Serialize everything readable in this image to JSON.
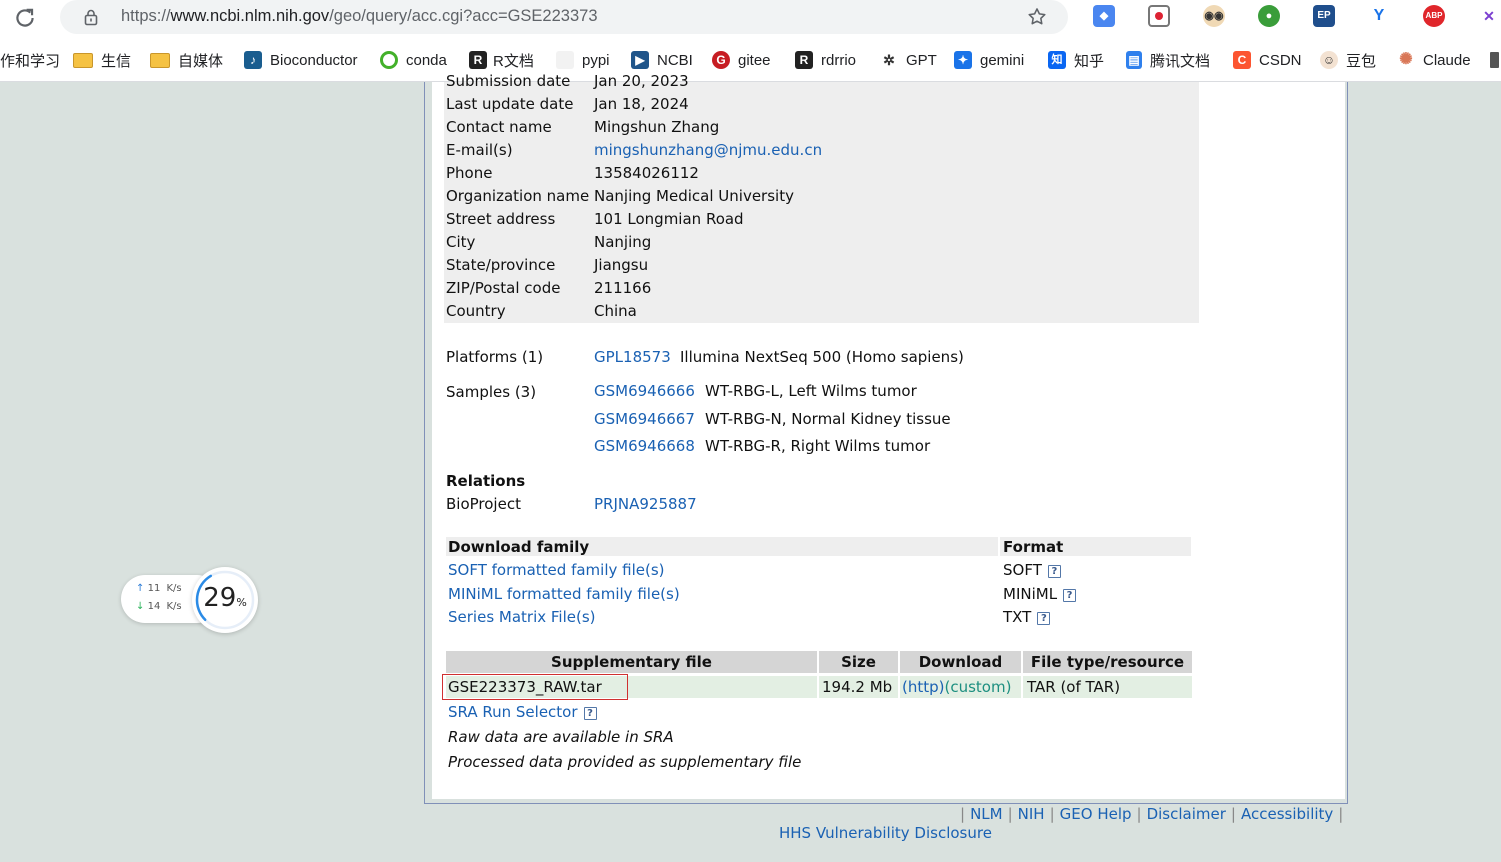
{
  "browser": {
    "url_scheme": "https://",
    "url_host": "www.ncbi.nlm.nih.gov",
    "url_path": "/geo/query/acc.cgi?acc=GSE223373"
  },
  "bookmarks": [
    {
      "label": "作和学习",
      "icon": "none"
    },
    {
      "label": "生信",
      "icon": "folder-icon"
    },
    {
      "label": "自媒体",
      "icon": "folder-icon"
    },
    {
      "label": "Bioconductor",
      "icon": "bioconductor-icon"
    },
    {
      "label": "conda",
      "icon": "conda-icon"
    },
    {
      "label": "R文档",
      "icon": "r-icon"
    },
    {
      "label": "pypi",
      "icon": "pypi-icon"
    },
    {
      "label": "NCBI",
      "icon": "ncbi-icon"
    },
    {
      "label": "gitee",
      "icon": "gitee-icon"
    },
    {
      "label": "rdrrio",
      "icon": "r-icon"
    },
    {
      "label": "GPT",
      "icon": "openai-icon"
    },
    {
      "label": "gemini",
      "icon": "gemini-icon"
    },
    {
      "label": "知乎",
      "icon": "zhihu-icon"
    },
    {
      "label": "腾讯文档",
      "icon": "doc-icon"
    },
    {
      "label": "CSDN",
      "icon": "csdn-icon"
    },
    {
      "label": "豆包",
      "icon": "doubao-icon"
    },
    {
      "label": "Claude",
      "icon": "claude-icon"
    }
  ],
  "contact": {
    "partial_row": {
      "label": "Submission date",
      "value": "Jan 20, 2023"
    },
    "rows": [
      {
        "label": "Last update date",
        "value": "Jan 18, 2024",
        "link": false
      },
      {
        "label": "Contact name",
        "value": "Mingshun Zhang",
        "link": false
      },
      {
        "label": "E-mail(s)",
        "value": "mingshunzhang@njmu.edu.cn",
        "link": true
      },
      {
        "label": "Phone",
        "value": "13584026112",
        "link": false
      },
      {
        "label": "Organization name",
        "value": "Nanjing Medical University",
        "link": false
      },
      {
        "label": "Street address",
        "value": "101 Longmian Road",
        "link": false
      },
      {
        "label": "City",
        "value": "Nanjing",
        "link": false
      },
      {
        "label": "State/province",
        "value": "Jiangsu",
        "link": false
      },
      {
        "label": "ZIP/Postal code",
        "value": "211166",
        "link": false
      },
      {
        "label": "Country",
        "value": "China",
        "link": false
      }
    ]
  },
  "platforms": {
    "label": "Platforms (1)",
    "items": [
      {
        "id": "GPL18573",
        "desc": "Illumina NextSeq 500 (Homo sapiens)"
      }
    ]
  },
  "samples": {
    "label": "Samples (3)",
    "items": [
      {
        "id": "GSM6946666",
        "desc": "WT-RBG-L, Left Wilms tumor"
      },
      {
        "id": "GSM6946667",
        "desc": "WT-RBG-N, Normal Kidney tissue"
      },
      {
        "id": "GSM6946668",
        "desc": "WT-RBG-R, Right Wilms tumor"
      }
    ]
  },
  "relations": {
    "heading": "Relations",
    "bioproject_label": "BioProject",
    "bioproject_id": "PRJNA925887"
  },
  "download_family": {
    "header": "Download family",
    "format_header": "Format",
    "rows": [
      {
        "label": "SOFT formatted family file(s)",
        "format": "SOFT"
      },
      {
        "label": "MINiML formatted family file(s)",
        "format": "MINiML"
      },
      {
        "label": "Series Matrix File(s)",
        "format": "TXT"
      }
    ]
  },
  "supplementary": {
    "headers": [
      "Supplementary file",
      "Size",
      "Download",
      "File type/resource"
    ],
    "file": "GSE223373_RAW.tar",
    "size": "194.2 Mb",
    "download_http": "(http)",
    "download_custom": "(custom)",
    "type": "TAR (of TAR)",
    "sra_link": "SRA Run Selector",
    "note1": "Raw data are available in SRA",
    "note2": "Processed data provided as supplementary file"
  },
  "footer": {
    "links": [
      "NLM",
      "NIH",
      "GEO Help",
      "Disclaimer",
      "Accessibility"
    ],
    "second_line": "HHS Vulnerability Disclosure"
  },
  "net_widget": {
    "up": "11",
    "down": "14",
    "unit": "K/s",
    "percent": "29",
    "percent_sign": "%"
  },
  "colors": {
    "link": "#1a61b3",
    "highlight_border": "#d03030",
    "page_bg": "#d9e1de"
  }
}
